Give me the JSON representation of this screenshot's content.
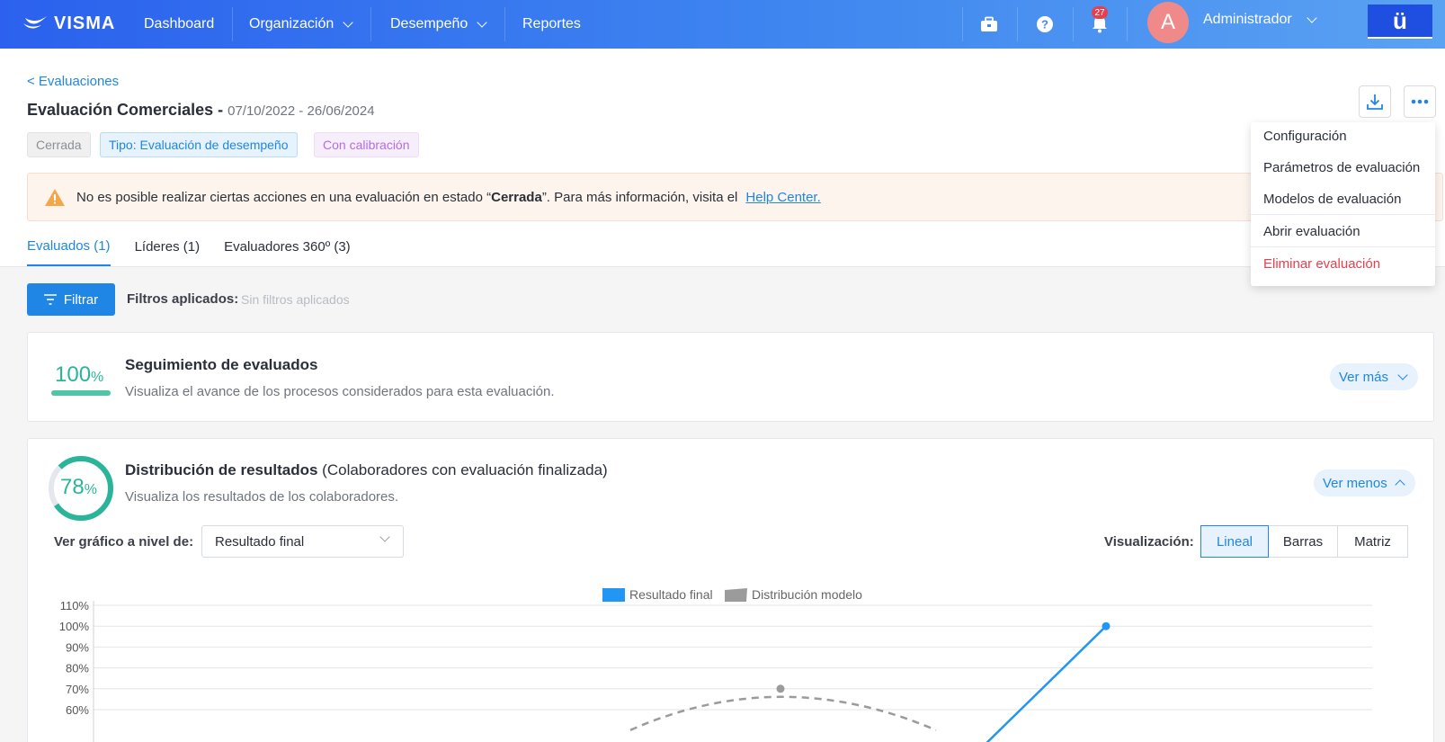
{
  "nav": {
    "brand": "VISMA",
    "items": [
      {
        "label": "Dashboard",
        "dropdown": false
      },
      {
        "label": "Organización",
        "dropdown": true
      },
      {
        "label": "Desempeño",
        "dropdown": true
      },
      {
        "label": "Reportes",
        "dropdown": false
      }
    ],
    "icons": [
      "briefcase-icon",
      "help-icon",
      "bell-icon"
    ],
    "notification_count": "27",
    "avatar_initial": "A",
    "user_name": "Administrador",
    "brand_button": "ü"
  },
  "header": {
    "back_link": "< Evaluaciones",
    "title": "Evaluación Comerciales -",
    "dates": "07/10/2022 - 26/06/2024",
    "tags": [
      "Cerrada",
      "Tipo: Evaluación de desempeño",
      "Con calibración"
    ]
  },
  "alert": {
    "text_before": "No es posible realizar ciertas acciones en una evaluación en estado “",
    "state": "Cerrada",
    "text_after": "”. Para más información, visita el",
    "link": "Help Center."
  },
  "tabs": [
    "Evaluados (1)",
    "Líderes (1)",
    "Evaluadores 360º (3)"
  ],
  "filters": {
    "button": "Filtrar",
    "label": "Filtros aplicados:",
    "value": "Sin filtros aplicados"
  },
  "tracking_card": {
    "percent": "100",
    "percent_symbol": "%",
    "progress": 1.0,
    "title": "Seguimiento de evaluados",
    "subtitle": "Visualiza el avance de los procesos considerados para esta evaluación.",
    "toggle": "Ver más"
  },
  "distribution_card": {
    "percent": "78",
    "percent_symbol": "%",
    "progress": 0.78,
    "title": "Distribución de resultados",
    "title_suffix": "(Colaboradores con evaluación finalizada)",
    "subtitle": "Visualiza los resultados de los colaboradores.",
    "toggle": "Ver menos",
    "level_label": "Ver gráfico a nivel de:",
    "level_value": "Resultado final",
    "visual_label": "Visualización:",
    "visual_options": [
      "Lineal",
      "Barras",
      "Matriz"
    ],
    "visual_selected": "Lineal"
  },
  "menu": {
    "items": [
      "Configuración",
      "Parámetros de evaluación",
      "Modelos de evaluación",
      "Abrir evaluación",
      "Eliminar evaluación"
    ]
  },
  "colors": {
    "accent": "#1f86e6",
    "success": "#2ab59a",
    "danger": "#e6404f",
    "model_series": "#9b9b9b"
  },
  "chart_data": {
    "type": "line",
    "legend": [
      "Resultado final",
      "Distribución modelo"
    ],
    "yticks": [
      "110%",
      "100%",
      "90%",
      "80%",
      "70%",
      "60%"
    ],
    "ylim": [
      60,
      110
    ],
    "series": [
      {
        "name": "Resultado final",
        "points": [
          {
            "y": 100
          }
        ]
      },
      {
        "name": "Distribución modelo",
        "points": [
          {
            "y": 70
          }
        ]
      }
    ]
  }
}
